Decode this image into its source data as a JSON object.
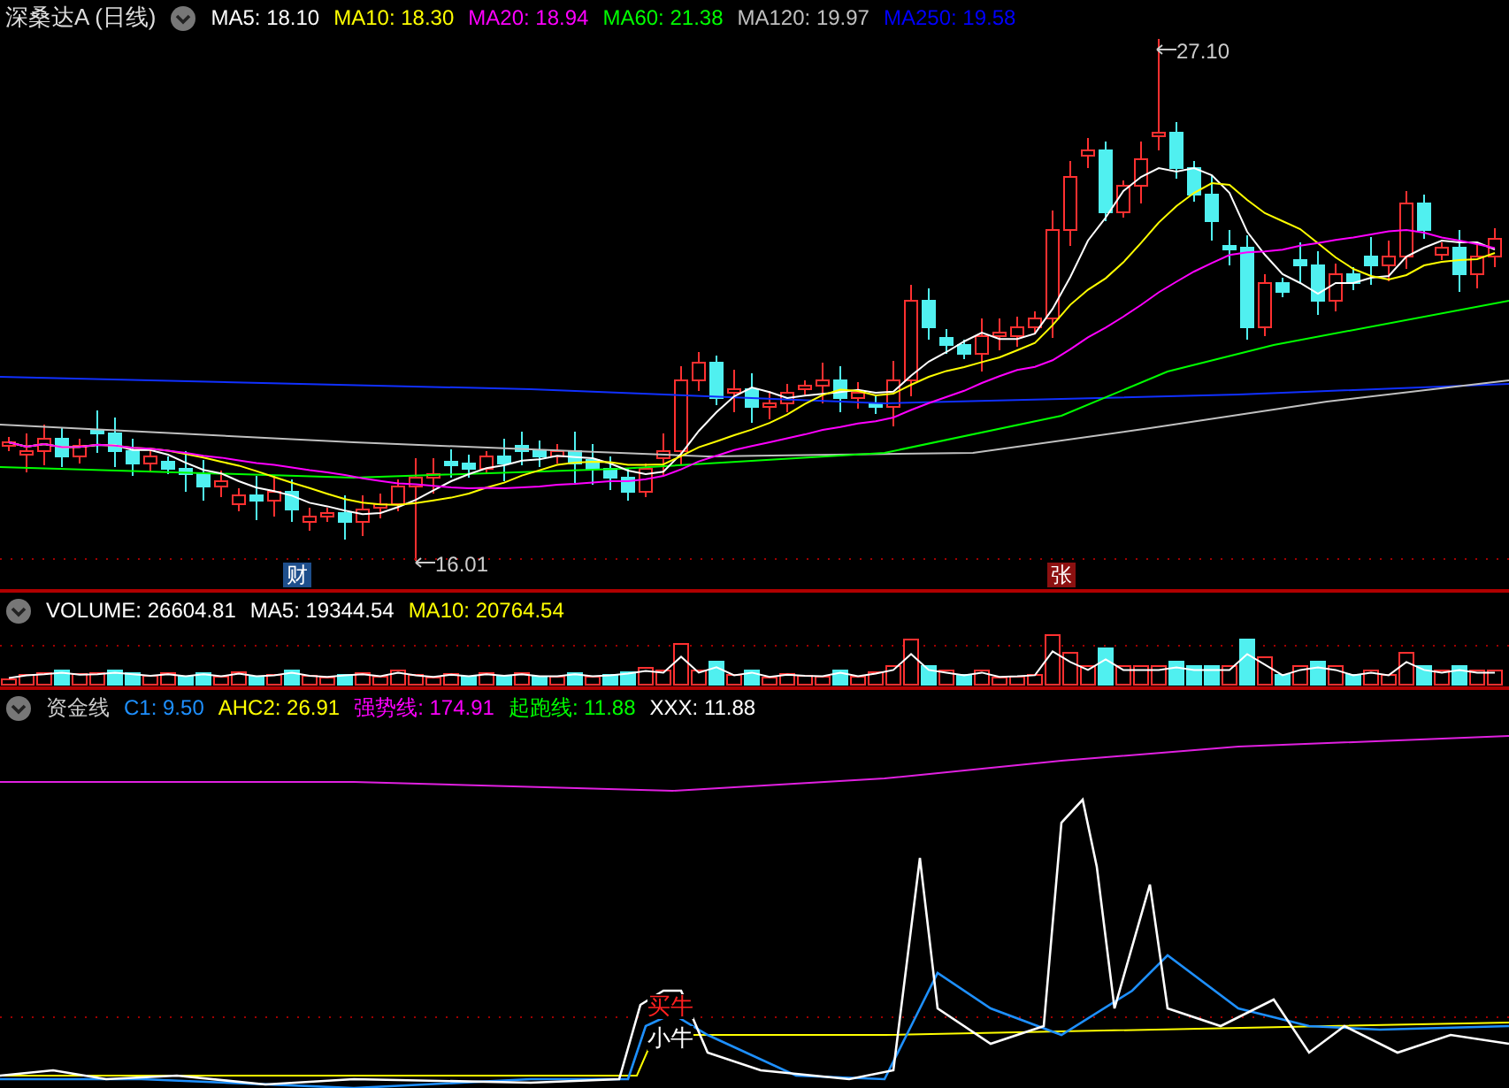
{
  "stock_title": "深桑达A (日线)",
  "main_legend": [
    {
      "label": "MA5: 18.10",
      "color": "#ffffff"
    },
    {
      "label": "MA10: 18.30",
      "color": "#ffff00"
    },
    {
      "label": "MA20: 18.94",
      "color": "#ff00ff"
    },
    {
      "label": "MA60: 21.38",
      "color": "#00ff00"
    },
    {
      "label": "MA120: 19.97",
      "color": "#c0c0c0"
    },
    {
      "label": "MA250: 19.58",
      "color": "#0000ff"
    }
  ],
  "price_high_label": "27.10",
  "price_low_label": "16.01",
  "event_markers": [
    {
      "text": "财",
      "color": "#1e4f8c"
    },
    {
      "text": "张",
      "color": "#8c1010"
    }
  ],
  "volume_legend": [
    {
      "label": "VOLUME: 26604.81",
      "color": "#ffffff"
    },
    {
      "label": "MA5: 19344.54",
      "color": "#ffffff"
    },
    {
      "label": "MA10: 20764.54",
      "color": "#ffff00"
    }
  ],
  "indicator_name": "资金线",
  "indicator_legend": [
    {
      "label": "C1: 9.50",
      "color": "#1e90ff"
    },
    {
      "label": "AHC2: 26.91",
      "color": "#ffff00"
    },
    {
      "label": "强势线: 174.91",
      "color": "#ff00ff"
    },
    {
      "label": "起跑线: 11.88",
      "color": "#00ff00"
    },
    {
      "label": "XXX: 11.88",
      "color": "#ffffff"
    }
  ],
  "signal_labels": [
    {
      "text": "买牛",
      "color": "#ff2020"
    },
    {
      "text": "小牛",
      "color": "#ffffff"
    }
  ]
}
